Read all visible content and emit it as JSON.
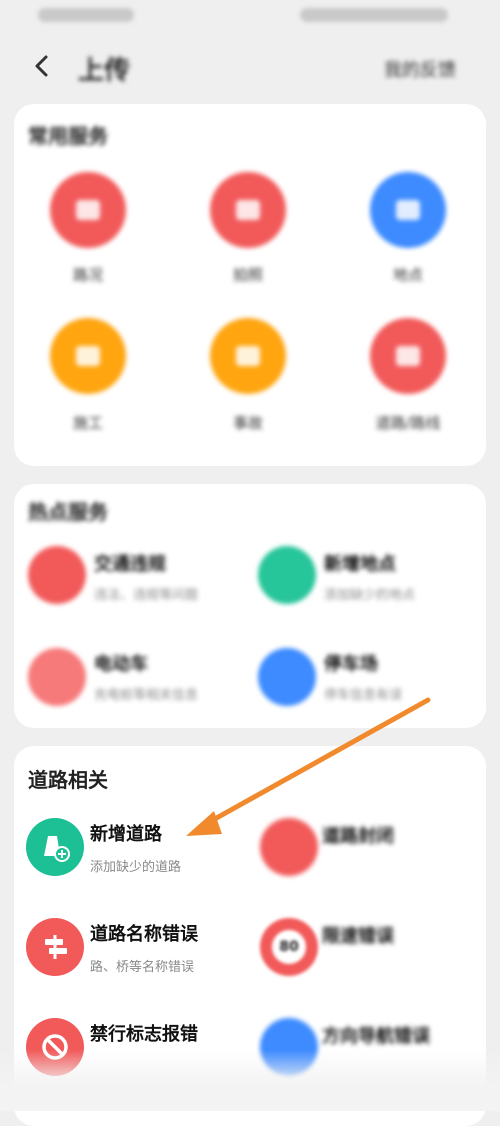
{
  "page": {
    "title": "上传",
    "top_action": "我的反馈"
  },
  "common": {
    "title": "常用服务",
    "items": [
      {
        "label": "路况",
        "color": "#f25a5a"
      },
      {
        "label": "拍照",
        "color": "#f25a5a"
      },
      {
        "label": "地点",
        "color": "#3d8bff"
      },
      {
        "label": "施工",
        "color": "#ffa510"
      },
      {
        "label": "事故",
        "color": "#ffa510"
      },
      {
        "label": "道路/路线",
        "color": "#f25a5a"
      }
    ]
  },
  "hot": {
    "title": "热点服务",
    "items": [
      {
        "title": "交通违规",
        "sub": "违法、违规等问题",
        "color": "#f25a5a"
      },
      {
        "title": "新增地点",
        "sub": "添加缺少的地点",
        "color": "#27c59a"
      },
      {
        "title": "电动车",
        "sub": "充电桩等相关信息",
        "color": "#f77a7a"
      },
      {
        "title": "停车场",
        "sub": "停车信息有误",
        "color": "#3d8bff"
      }
    ]
  },
  "road": {
    "title": "道路相关",
    "items": [
      {
        "title": "新增道路",
        "sub": "添加缺少的道路",
        "color": "#1dbf95",
        "blurred": false
      },
      {
        "title": "道路封闭",
        "sub": "",
        "color": "#f25a5a",
        "blurred": true
      },
      {
        "title": "道路名称错误",
        "sub": "路、桥等名称错误",
        "color": "#f25a5a",
        "blurred": false
      },
      {
        "title": "限速错误",
        "sub": "",
        "speed": "80",
        "color": "#f25a5a",
        "blurred": true
      },
      {
        "title": "禁行标志报错",
        "sub": "",
        "color": "#f25a5a",
        "blurred": false
      },
      {
        "title": "方向导航错误",
        "sub": "",
        "color": "#3d8bff",
        "blurred": true
      }
    ]
  },
  "annotation": {
    "color": "#f08a2c"
  }
}
